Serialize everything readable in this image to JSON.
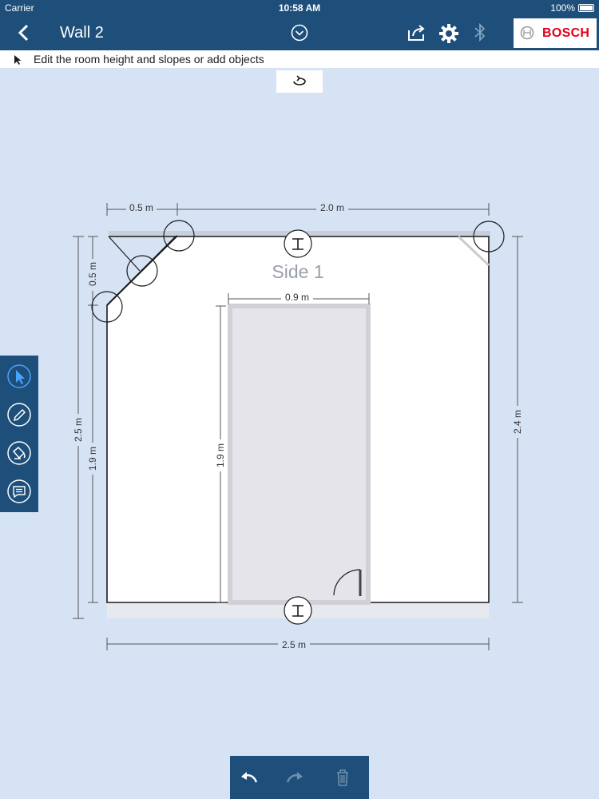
{
  "status": {
    "carrier": "Carrier",
    "time": "10:58 AM",
    "battery": "100%"
  },
  "header": {
    "title": "Wall 2",
    "logo": "BOSCH"
  },
  "hint": {
    "text": "Edit the room height and slopes or add objects"
  },
  "wall": {
    "side_label": "Side 1",
    "dims": {
      "top_left": "0.5 m",
      "top_right": "2.0 m",
      "left_slope": "0.5 m",
      "left_outer": "2.5 m",
      "left_inner": "1.9 m",
      "door_width": "0.9 m",
      "door_height": "1.9 m",
      "right": "2.4 m",
      "bottom": "2.5 m"
    }
  },
  "icons": {
    "back": "chevron-left-icon",
    "dropdown": "chevron-down-circle-icon",
    "share": "share-icon",
    "settings": "gear-icon",
    "bluetooth": "bluetooth-icon",
    "rotate": "rotate-icon",
    "tools": [
      "pointer-icon",
      "pencil-icon",
      "paint-bucket-icon",
      "comment-icon"
    ],
    "undo": "undo-icon",
    "redo": "redo-icon",
    "delete": "trash-icon"
  },
  "colors": {
    "bar": "#1d4f7a",
    "background": "#d6e3f5",
    "logo_red": "#e2001a",
    "active_tool": "#4aa3ff"
  }
}
